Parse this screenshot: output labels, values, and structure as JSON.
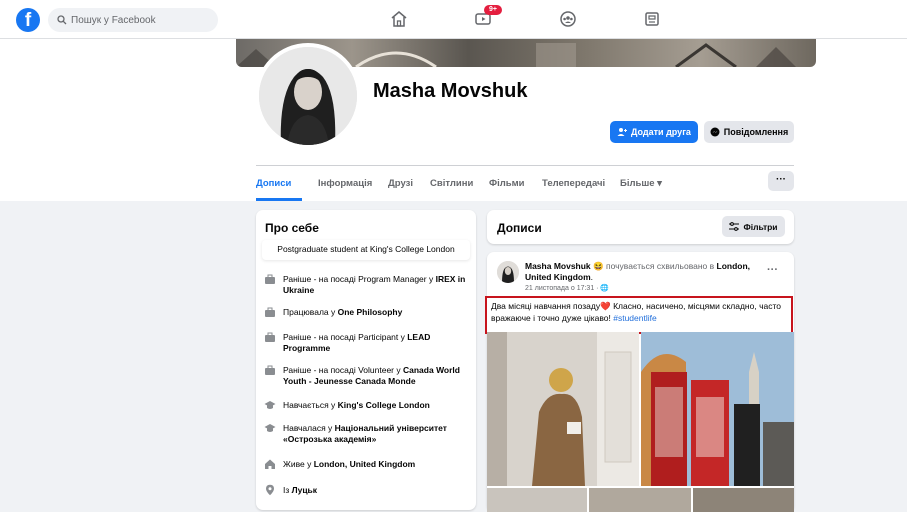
{
  "topbar": {
    "search_placeholder": "Пошук у Facebook",
    "notification_badge": "9+",
    "icons": [
      "home-icon",
      "watch-icon",
      "groups-icon",
      "gaming-icon"
    ]
  },
  "profile": {
    "name": "Masha Movshuk",
    "add_friend_label": "Додати друга",
    "message_label": "Повідомлення",
    "tabs": [
      {
        "label": "Дописи",
        "active": true
      },
      {
        "label": "Інформація"
      },
      {
        "label": "Друзі"
      },
      {
        "label": "Світлини"
      },
      {
        "label": "Фільми"
      },
      {
        "label": "Телепередачі"
      },
      {
        "label": "Більше ▾"
      }
    ],
    "more_button": "···"
  },
  "intro": {
    "title": "Про себе",
    "bio": "Postgraduate student at King's College London",
    "items": [
      {
        "icon": "work-icon",
        "prefix": "Раніше - на посаді Program Manager у ",
        "bold": "IREX in Ukraine"
      },
      {
        "icon": "work-icon",
        "prefix": "Працювала у ",
        "bold": "One Philosophy"
      },
      {
        "icon": "work-icon",
        "prefix": "Раніше - на посаді Participant у ",
        "bold": "LEAD Programme"
      },
      {
        "icon": "work-icon",
        "prefix": "Раніше - на посаді Volunteer у ",
        "bold": "Canada World Youth - Jeunesse Canada Monde"
      },
      {
        "icon": "education-icon",
        "prefix": "Навчається у ",
        "bold": "King's College London"
      },
      {
        "icon": "education-icon",
        "prefix": "Навчалася у ",
        "bold": "Національний університет «Острозька академія»"
      },
      {
        "icon": "home-icon",
        "prefix": "Живе у ",
        "bold": "London, United Kingdom"
      },
      {
        "icon": "location-icon",
        "prefix": "Із ",
        "bold": "Луцьк"
      }
    ]
  },
  "posts": {
    "title": "Дописи",
    "filter_label": "Фільтри",
    "post": {
      "author": "Masha Movshuk",
      "emoji": "😆",
      "feeling": " почувається схвильовано в ",
      "place": "London, United Kingdom",
      "place_suffix": ".",
      "date": "21 листопада о 17:31 · 🌐",
      "more": "···",
      "text": "Два місяці навчання позаду",
      "heart": "❤️",
      "text2": " Класно, насичено, місцями складно, часто вражаюче і точно дуже цікаво! ",
      "hashtag": "#studentlife"
    }
  },
  "colors": {
    "accent": "#1877f2",
    "highlight_border": "#c7141d",
    "badge": "#e41e3f"
  }
}
